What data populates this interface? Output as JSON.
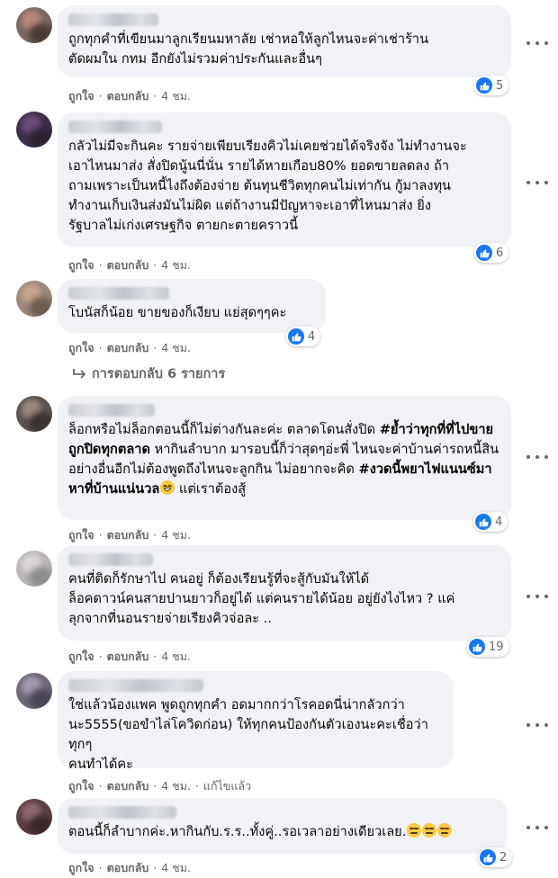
{
  "comments": [
    {
      "text_lines": [
        "ถูกทุกคำที่เขียนมาลูกเรียนมหาลัย เช่าหอให้ลูกไหนจะค่าเช่าร้าน",
        "ตัดผมใน กทม อีกยังไม่รวมค่าประกันและอื่นๆ"
      ],
      "like_label": "ถูกใจ",
      "reply_label": "ตอบกลับ",
      "time": "4 ชม.",
      "reaction_count": "5"
    },
    {
      "text_lines": [
        "กลัวไม่มีจะกินคะ รายจ่ายเพียบเรียงคิวไม่เคยช่วยได้จริงจัง ไม่ทำงานจะ",
        "เอาไหนมาส่ง สั่งปิดนู้นนี่นั่น รายได้หายเกือบ80% ยอดขายลดลง ถ้า",
        "ถามเพราะเป็นหนี้ไงถึงต้องจ่าย ต้นทุนชีวิตทุกคนไม่เท่ากัน กู้มาลงทุน",
        "ทำงานเก็บเงินส่งมันไม่ผิด แต่ถ้างานมีปัญหาจะเอาที่ไหนมาส่ง ยิ่ง",
        "รัฐบาลไม่เก่งเศรษฐกิจ ตายกะตายคราวนี้"
      ],
      "like_label": "ถูกใจ",
      "reply_label": "ตอบกลับ",
      "time": "4 ชม.",
      "reaction_count": "6"
    },
    {
      "text_lines": [
        "โบนัสก็น้อย ขายของก็เงียบ แย่สุดๆๆคะ"
      ],
      "like_label": "ถูกใจ",
      "reply_label": "ตอบกลับ",
      "time": "4 ชม.",
      "reaction_count": "4"
    },
    {
      "text_a": "ล็อกหรือไม่ล็อกตอนนี้ก็ไม่ต่างกันละค่ะ ตลาดโดนสั่งปิด ",
      "hashtag1": "#ย้ำว่าทุกที่ที่ไปขายถูกปิดทุกตลาด",
      "text_b": " หากินลำบาก มารอบนี้ก็ว่าสุดๆอ่ะพี่ ไหนจะค่าบ้านค่ารถหนี้สินอย่างอื่นอีกไม่ต้องพูดถึงไหนจะลูกกิน ไม่อยากจะคิด ",
      "hashtag2": "#งวดนี้พยาไฟแนนซ์มาหาที่บ้านแน่นวล",
      "text_c": " แต่เราต้องสู้",
      "like_label": "ถูกใจ",
      "reply_label": "ตอบกลับ",
      "time": "4 ชม.",
      "reaction_count": "4"
    },
    {
      "text_lines": [
        "คนที่ติดก็รักษาไป คนอยู่ ก็ต้องเรียนรู้ที่จะสู้กับมันให้ได้",
        "ล็อคดาวน์คนสายปานยาวก็อยู่ได้ แต่คนรายได้น้อย อยู่ยังไงไหว ? แค่",
        "ลุกจากที่นอนรายจ่ายเรียงคิวจ่อละ .."
      ],
      "like_label": "ถูกใจ",
      "reply_label": "ตอบกลับ",
      "time": "4 ชม.",
      "reaction_count": "19"
    },
    {
      "text_lines": [
        "ใช่แล้วน้องแพค พูดถูกทุกคำ อดมากกว่าโรคอดนี่น่ากลัวกว่า",
        "นะ5555(ขอขำไล่โควิดก่อน) ให้ทุกคนป้องกันตัวเองนะคะเชื่อว่าทุกๆ",
        "คนทำได้คะ"
      ],
      "like_label": "ถูกใจ",
      "reply_label": "ตอบกลับ",
      "time": "4 ชม.",
      "edited_label": "แก้ไขแล้ว"
    },
    {
      "text_main": "ตอนนี้ก็ลำบากค่ะ.หากินกับ.ร.ร..ทั้งคู่..รอเวลาอย่างเดียวเลย.",
      "like_label": "ถูกใจ",
      "reply_label": "ตอบกลับ",
      "time": "4 ชม.",
      "reaction_count": "2"
    }
  ],
  "view_replies_label": "การตอบกลับ 6 รายการ",
  "colors": {
    "bubble": "#f0f2f5",
    "like_blue": "#1877f2",
    "meta_text": "#65676b"
  }
}
